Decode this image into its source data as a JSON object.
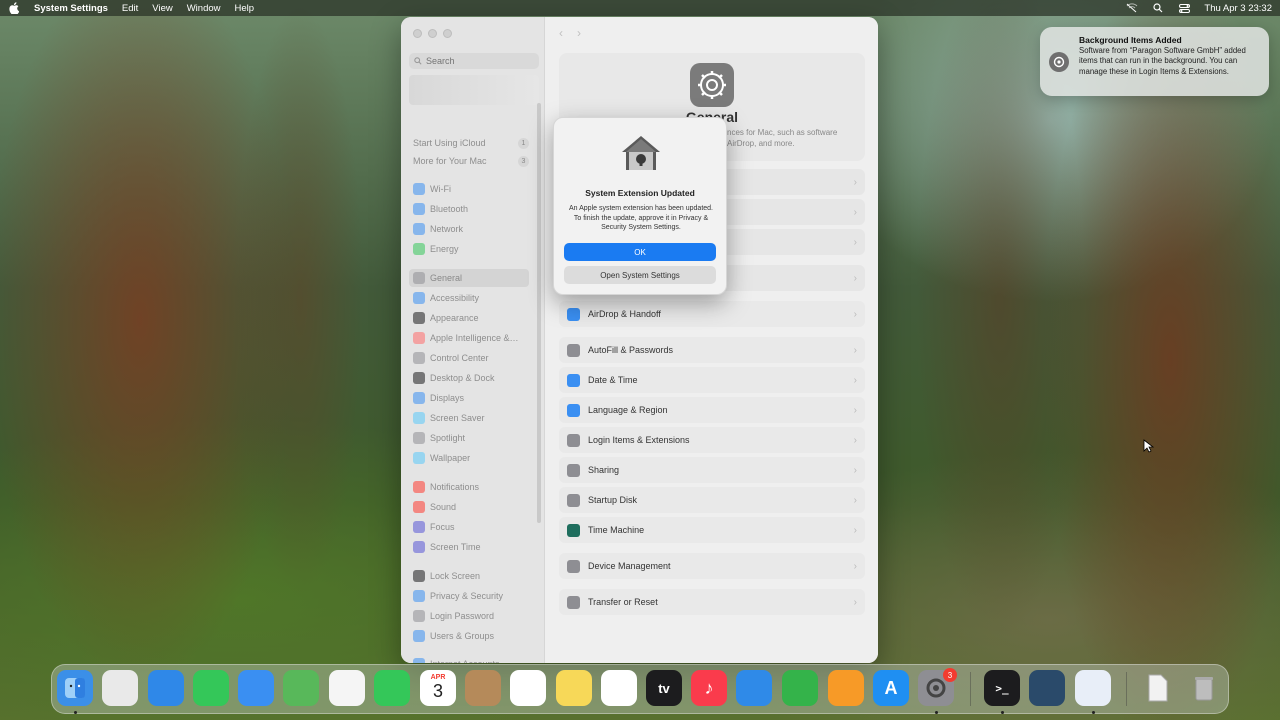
{
  "menubar": {
    "app_name": "System Settings",
    "items": [
      "Edit",
      "View",
      "Window",
      "Help"
    ],
    "datetime": "Thu Apr 3  23:32"
  },
  "window": {
    "search_placeholder": "Search",
    "sidebar": {
      "top_items": [
        {
          "label": "Start Using iCloud",
          "badge": "1"
        },
        {
          "label": "More for Your Mac",
          "badge": "3"
        }
      ],
      "items": [
        {
          "label": "Wi-Fi",
          "color": "#3a8ff2"
        },
        {
          "label": "Bluetooth",
          "color": "#3a8ff2"
        },
        {
          "label": "Network",
          "color": "#3a8ff2"
        },
        {
          "label": "Energy",
          "color": "#34c759"
        },
        {
          "label": "General",
          "color": "#8e8e93"
        },
        {
          "label": "Accessibility",
          "color": "#3a8ff2"
        },
        {
          "label": "Appearance",
          "color": "#1c1c1e"
        },
        {
          "label": "Apple Intelligence &…",
          "color": "#ff6b6b"
        },
        {
          "label": "Control Center",
          "color": "#8e8e93"
        },
        {
          "label": "Desktop & Dock",
          "color": "#1c1c1e"
        },
        {
          "label": "Displays",
          "color": "#3a8ff2"
        },
        {
          "label": "Screen Saver",
          "color": "#5ac8fa"
        },
        {
          "label": "Spotlight",
          "color": "#8e8e93"
        },
        {
          "label": "Wallpaper",
          "color": "#5ac8fa"
        },
        {
          "label": "Notifications",
          "color": "#ff3b30"
        },
        {
          "label": "Sound",
          "color": "#ff3b30"
        },
        {
          "label": "Focus",
          "color": "#5856d6"
        },
        {
          "label": "Screen Time",
          "color": "#5856d6"
        },
        {
          "label": "Lock Screen",
          "color": "#1c1c1e"
        },
        {
          "label": "Privacy & Security",
          "color": "#3a8ff2"
        },
        {
          "label": "Login Password",
          "color": "#8e8e93"
        },
        {
          "label": "Users & Groups",
          "color": "#3a8ff2"
        },
        {
          "label": "Internet Accounts",
          "color": "#3a8ff2"
        }
      ],
      "selected": "General"
    },
    "hero": {
      "title": "General",
      "description": "nces for Mac, such as software AirDrop, and more."
    },
    "rows": [
      {
        "label": "AirDrop & Handoff",
        "color": "#3a8ff2"
      },
      {
        "label": "AutoFill & Passwords",
        "color": "#8e8e93"
      },
      {
        "label": "Date & Time",
        "color": "#3a8ff2"
      },
      {
        "label": "Language & Region",
        "color": "#3a8ff2"
      },
      {
        "label": "Login Items & Extensions",
        "color": "#8e8e93"
      },
      {
        "label": "Sharing",
        "color": "#8e8e93"
      },
      {
        "label": "Startup Disk",
        "color": "#8e8e93"
      },
      {
        "label": "Time Machine",
        "color": "#1f6e5e"
      },
      {
        "label": "Device Management",
        "color": "#8e8e93"
      },
      {
        "label": "Transfer or Reset",
        "color": "#8e8e93"
      }
    ]
  },
  "dialog": {
    "title": "System Extension Updated",
    "message": "An Apple system extension has been updated. To finish the update, approve it in Privacy & Security System Settings.",
    "ok_label": "OK",
    "open_label": "Open System Settings"
  },
  "notification": {
    "title": "Background Items Added",
    "body": "Software from “Paragon Software GmbH” added items that can run in the background. You can manage these in Login Items & Extensions."
  },
  "dock": {
    "apps": [
      {
        "name": "Finder",
        "color": "#3b8fe8"
      },
      {
        "name": "Launchpad",
        "color": "#e9e9e9"
      },
      {
        "name": "Safari",
        "color": "#2f88e8"
      },
      {
        "name": "Messages",
        "color": "#34c759"
      },
      {
        "name": "Mail",
        "color": "#3a8ff2"
      },
      {
        "name": "Maps",
        "color": "#58b85a"
      },
      {
        "name": "Photos",
        "color": "#f5f5f5"
      },
      {
        "name": "FaceTime",
        "color": "#34c759"
      },
      {
        "name": "Calendar",
        "color": "#ffffff"
      },
      {
        "name": "Contacts",
        "color": "#b58a5a"
      },
      {
        "name": "Reminders",
        "color": "#ffffff"
      },
      {
        "name": "Notes",
        "color": "#f7d858"
      },
      {
        "name": "Freeform",
        "color": "#ffffff"
      },
      {
        "name": "TV",
        "color": "#1c1c1e"
      },
      {
        "name": "Music",
        "color": "#fa3b4c"
      },
      {
        "name": "Keynote",
        "color": "#2f8ae8"
      },
      {
        "name": "Numbers",
        "color": "#34b34a"
      },
      {
        "name": "Pages",
        "color": "#f79a27"
      },
      {
        "name": "App Store",
        "color": "#1f8ff2"
      },
      {
        "name": "System Settings",
        "color": "#8e8e93"
      },
      {
        "name": "Terminal",
        "color": "#1c1c1e"
      },
      {
        "name": "QuickTime",
        "color": "#2a4a6a"
      },
      {
        "name": "Paragon",
        "color": "#e8eef8"
      },
      {
        "name": "Document",
        "color": "#e6e6e6"
      },
      {
        "name": "Trash",
        "color": "#d8d8d8"
      }
    ],
    "calendar_month": "APR",
    "calendar_day": "3",
    "tv_label": "tv",
    "settings_badge": "3"
  }
}
